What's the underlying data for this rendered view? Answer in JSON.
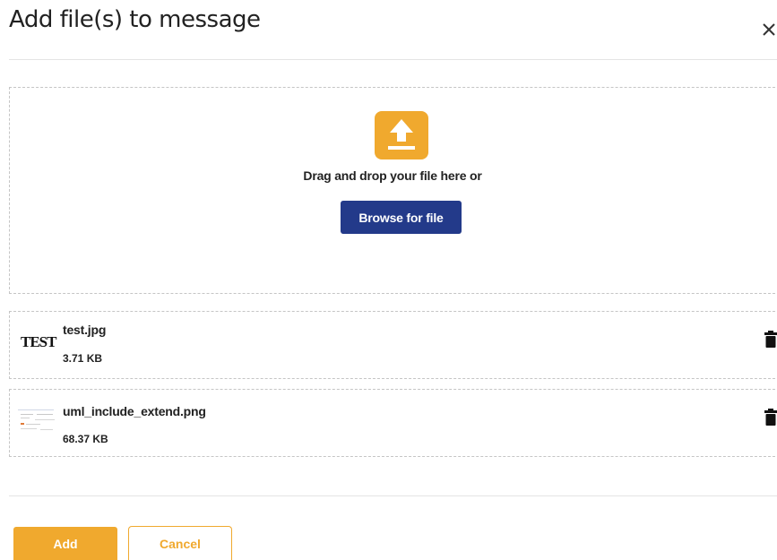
{
  "dialog": {
    "title": "Add file(s) to message"
  },
  "dropzone": {
    "instruction": "Drag and drop your file here or",
    "browse_label": "Browse for file"
  },
  "files": [
    {
      "name": "test.jpg",
      "size": "3.71 KB",
      "thumbnail_text": "TEST"
    },
    {
      "name": "uml_include_extend.png",
      "size": "68.37 KB"
    }
  ],
  "footer": {
    "add_label": "Add",
    "cancel_label": "Cancel"
  },
  "colors": {
    "accent": "#f0a92e",
    "primary": "#233a8a"
  }
}
